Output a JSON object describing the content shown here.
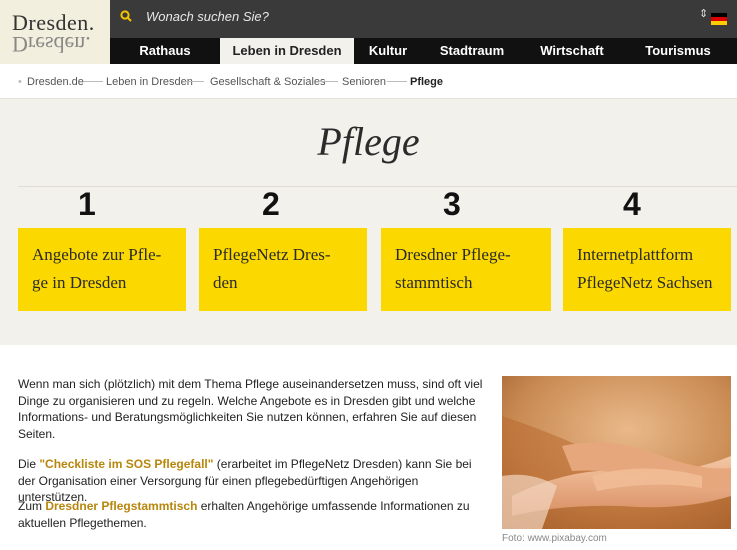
{
  "logo": {
    "text": "Dresden."
  },
  "search": {
    "placeholder": "Wonach suchen Sie?"
  },
  "lang": {
    "arrows": "⇕"
  },
  "nav": {
    "items": [
      "Rathaus",
      "Leben in Dresden",
      "Kultur",
      "Stadtraum",
      "Wirtschaft",
      "Tourismus"
    ],
    "active": "Leben in Dresden"
  },
  "breadcrumb": {
    "items": [
      "Dresden.de",
      "Leben in Dresden",
      "Gesellschaft & Soziales",
      "Senioren",
      "Pflege"
    ]
  },
  "page": {
    "title": "Pflege"
  },
  "tiles": [
    {
      "num": "1",
      "line1": "Angebote zur Pfle-",
      "line2": "ge in Dresden"
    },
    {
      "num": "2",
      "line1": "PflegeNetz Dres-",
      "line2": "den"
    },
    {
      "num": "3",
      "line1": "Dresdner Pflege-",
      "line2": "stammtisch"
    },
    {
      "num": "4",
      "line1": "Internetplattform",
      "line2": "PflegeNetz Sachsen"
    }
  ],
  "content": {
    "p1": "Wenn man sich (plötzlich) mit dem Thema Pflege auseinandersetzen muss, sind oft viel Dinge zu organisieren und zu regeln. Welche Angebote es in Dresden gibt und welche Informations- und Beratungsmöglichkeiten Sie nutzen können, erfahren Sie auf diesen Seiten.",
    "p2_pre": "Die ",
    "p2_link": "\"Checkliste im SOS Pflegefall\"",
    "p2_post": " (erarbeitet im PflegeNetz Dresden) kann Sie bei der Organisation einer Versorgung für einen pflegebedürftigen Angehörigen unterstützen.",
    "p3_pre": "Zum ",
    "p3_link": "Dresdner Pflegstammtisch",
    "p3_post": " erhalten Angehörige umfassende Informationen zu aktuellen Pflegethemen.",
    "caption": "Foto: www.pixabay.com"
  },
  "colors": {
    "accent": "#fbd900",
    "link": "#b7860b",
    "header": "#1a1a1a"
  }
}
